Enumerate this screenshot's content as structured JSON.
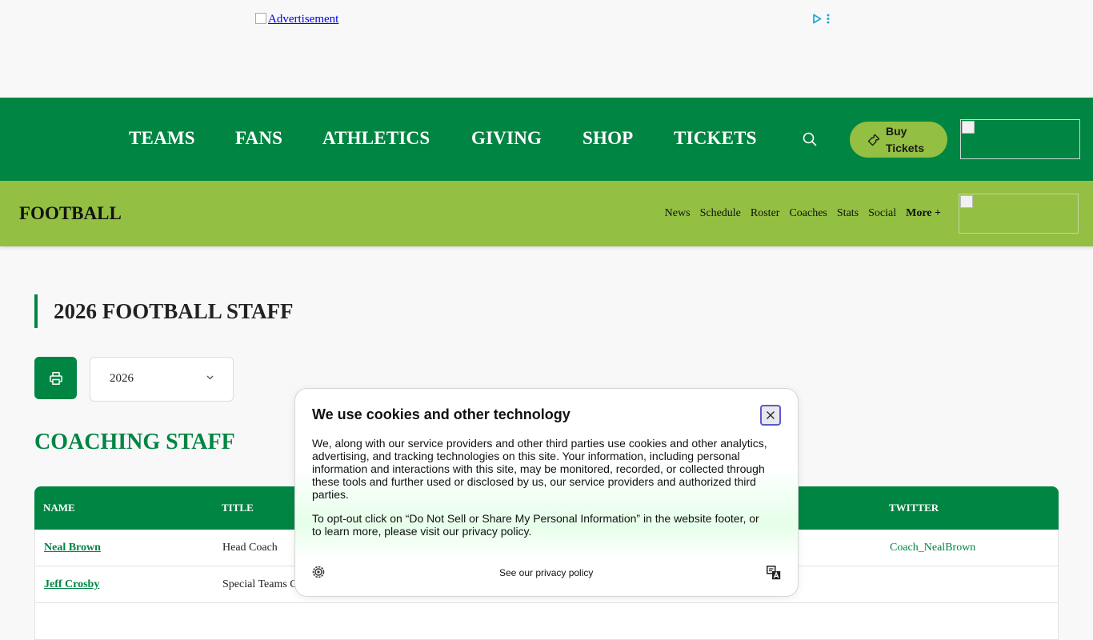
{
  "ad": {
    "label": "Advertisement"
  },
  "main_nav": {
    "items": [
      "TEAMS",
      "FANS",
      "ATHLETICS",
      "GIVING",
      "SHOP",
      "TICKETS"
    ],
    "buy_tickets": "Buy Tickets"
  },
  "sub_nav": {
    "sport": "FOOTBALL",
    "links": [
      "News",
      "Schedule",
      "Roster",
      "Coaches",
      "Stats",
      "Social"
    ],
    "more": "More +"
  },
  "page": {
    "heading": "2026 FOOTBALL STAFF",
    "year_selected": "2026",
    "section_title": "COACHING STAFF"
  },
  "table": {
    "headers": {
      "name": "NAME",
      "title": "TITLE",
      "twitter": "TWITTER"
    },
    "rows": [
      {
        "name": "Neal Brown",
        "title": "Head Coach",
        "twitter": "Coach_NealBrown"
      },
      {
        "name": "Jeff Crosby",
        "title": "Special Teams C",
        "twitter": ""
      }
    ]
  },
  "cookie": {
    "title": "We use cookies and other technology",
    "body1": "We, along with our service providers and other third parties use cookies and other analytics, advertising, and tracking technologies on this site. Your information, including personal information and interactions with this site, may be monitored, recorded, or collected through these tools and further used or disclosed by us, our service providers and authorized third parties.",
    "body2": "To opt-out click on “Do Not Sell or Share My Personal Information” in the website footer, or to learn more, please visit our privacy policy.",
    "privacy_link": "See our privacy policy"
  },
  "colors": {
    "primary_green": "#008542",
    "accent_green": "#93bf42",
    "background": "#f8f8f9"
  }
}
